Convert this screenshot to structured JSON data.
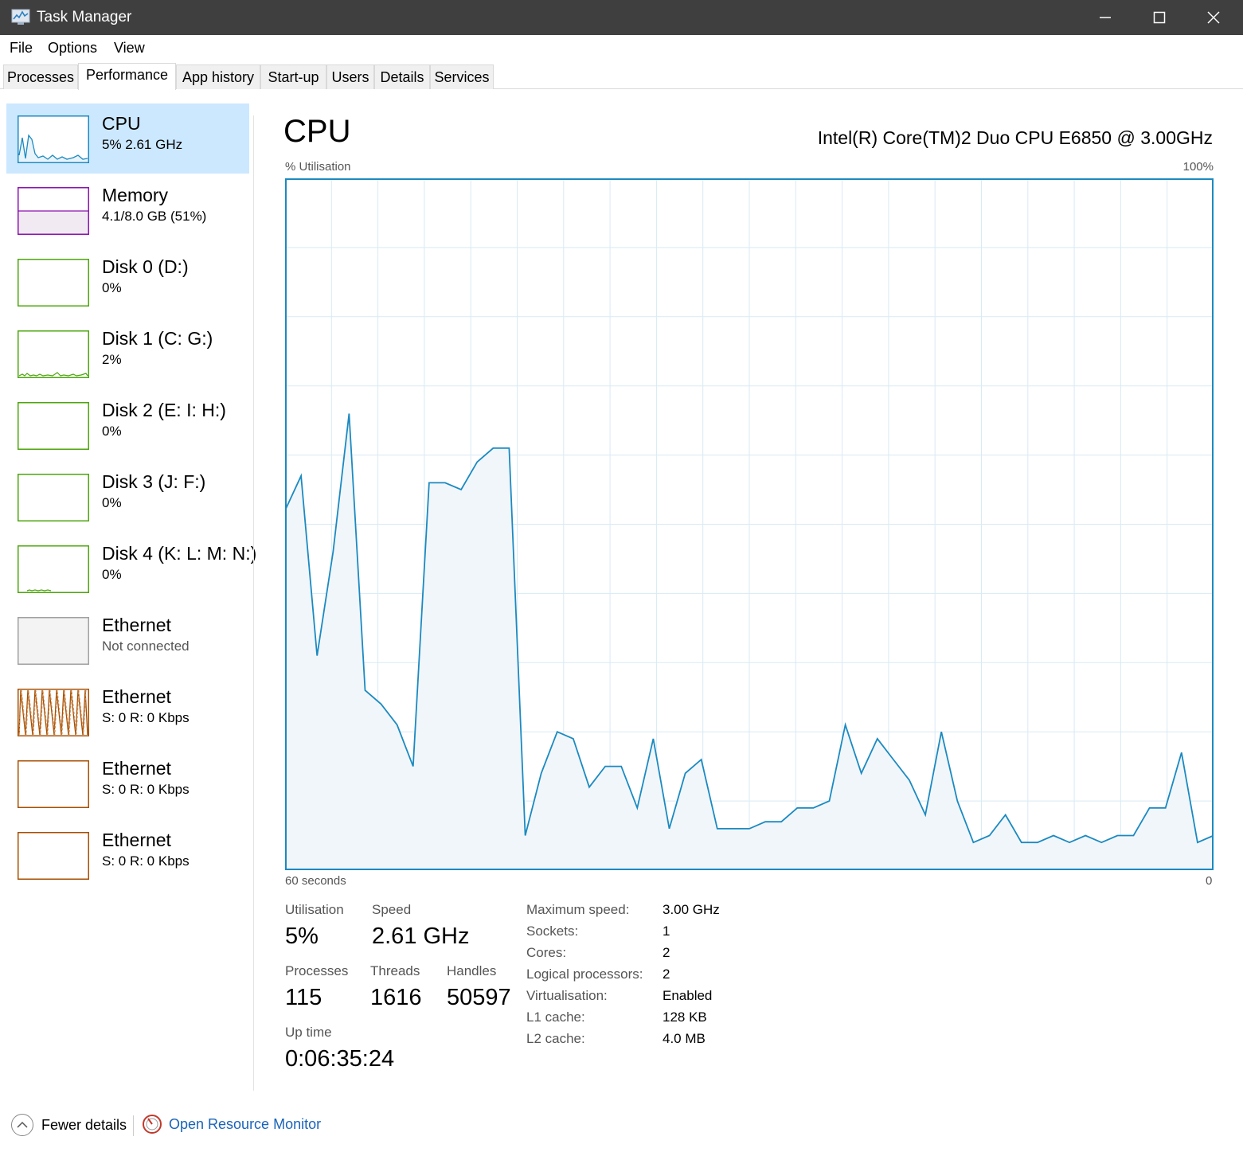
{
  "window": {
    "title": "Task Manager",
    "minimize": "—",
    "maximize": "☐",
    "close": "✕"
  },
  "menu": [
    "File",
    "Options",
    "View"
  ],
  "tabs": [
    "Processes",
    "Performance",
    "App history",
    "Start-up",
    "Users",
    "Details",
    "Services"
  ],
  "active_tab": "Performance",
  "sidebar": {
    "items": [
      {
        "name": "CPU",
        "sub": "5% 2.61 GHz",
        "color": "#1b8ac0",
        "selected": true
      },
      {
        "name": "Memory",
        "sub": "4.1/8.0 GB (51%)",
        "color": "#8b12ae"
      },
      {
        "name": "Disk 0 (D:)",
        "sub": "0%",
        "color": "#4da60c"
      },
      {
        "name": "Disk 1 (C: G:)",
        "sub": "2%",
        "color": "#4da60c"
      },
      {
        "name": "Disk 2 (E: I: H:)",
        "sub": "0%",
        "color": "#4da60c"
      },
      {
        "name": "Disk 3 (J: F:)",
        "sub": "0%",
        "color": "#4da60c"
      },
      {
        "name": "Disk 4 (K: L: M: N:)",
        "sub": "0%",
        "color": "#4da60c"
      },
      {
        "name": "Ethernet",
        "sub": "Not connected",
        "color": "#a0a0a0"
      },
      {
        "name": "Ethernet",
        "sub": "S: 0 R: 0 Kbps",
        "color": "#a74f01"
      },
      {
        "name": "Ethernet",
        "sub": "S: 0 R: 0 Kbps",
        "color": "#a74f01"
      },
      {
        "name": "Ethernet",
        "sub": "S: 0 R: 0 Kbps",
        "color": "#a74f01"
      }
    ]
  },
  "main": {
    "title": "CPU",
    "model": "Intel(R) Core(TM)2 Duo CPU E6850 @ 3.00GHz",
    "y_label": "% Utilisation",
    "y_max_label": "100%",
    "x_left_label": "60 seconds",
    "x_right_label": "0"
  },
  "chart_data": {
    "type": "area",
    "x_range": [
      60,
      0
    ],
    "ylim": [
      0,
      100
    ],
    "grid": true,
    "values": [
      52,
      57,
      31,
      46,
      66,
      26,
      24,
      21,
      15,
      56,
      56,
      55,
      59,
      61,
      61,
      5,
      14,
      20,
      19,
      12,
      15,
      15,
      9,
      19,
      6,
      14,
      16,
      6,
      6,
      6,
      7,
      7,
      9,
      9,
      10,
      21,
      14,
      19,
      16,
      13,
      8,
      20,
      10,
      4,
      5,
      8,
      4,
      4,
      5,
      4,
      5,
      4,
      5,
      5,
      9,
      9,
      17,
      4,
      5
    ]
  },
  "stats": {
    "utilisation_label": "Utilisation",
    "utilisation": "5%",
    "speed_label": "Speed",
    "speed": "2.61 GHz",
    "processes_label": "Processes",
    "processes": "115",
    "threads_label": "Threads",
    "threads": "1616",
    "handles_label": "Handles",
    "handles": "50597",
    "uptime_label": "Up time",
    "uptime": "0:06:35:24"
  },
  "details": [
    {
      "key": "Maximum speed:",
      "value": "3.00 GHz"
    },
    {
      "key": "Sockets:",
      "value": "1"
    },
    {
      "key": "Cores:",
      "value": "2"
    },
    {
      "key": "Logical processors:",
      "value": "2"
    },
    {
      "key": "Virtualisation:",
      "value": "Enabled"
    },
    {
      "key": "L1 cache:",
      "value": "128 KB"
    },
    {
      "key": "L2 cache:",
      "value": "4.0 MB"
    }
  ],
  "footer": {
    "fewer_details": "Fewer details",
    "open_resource_monitor": "Open Resource Monitor"
  }
}
